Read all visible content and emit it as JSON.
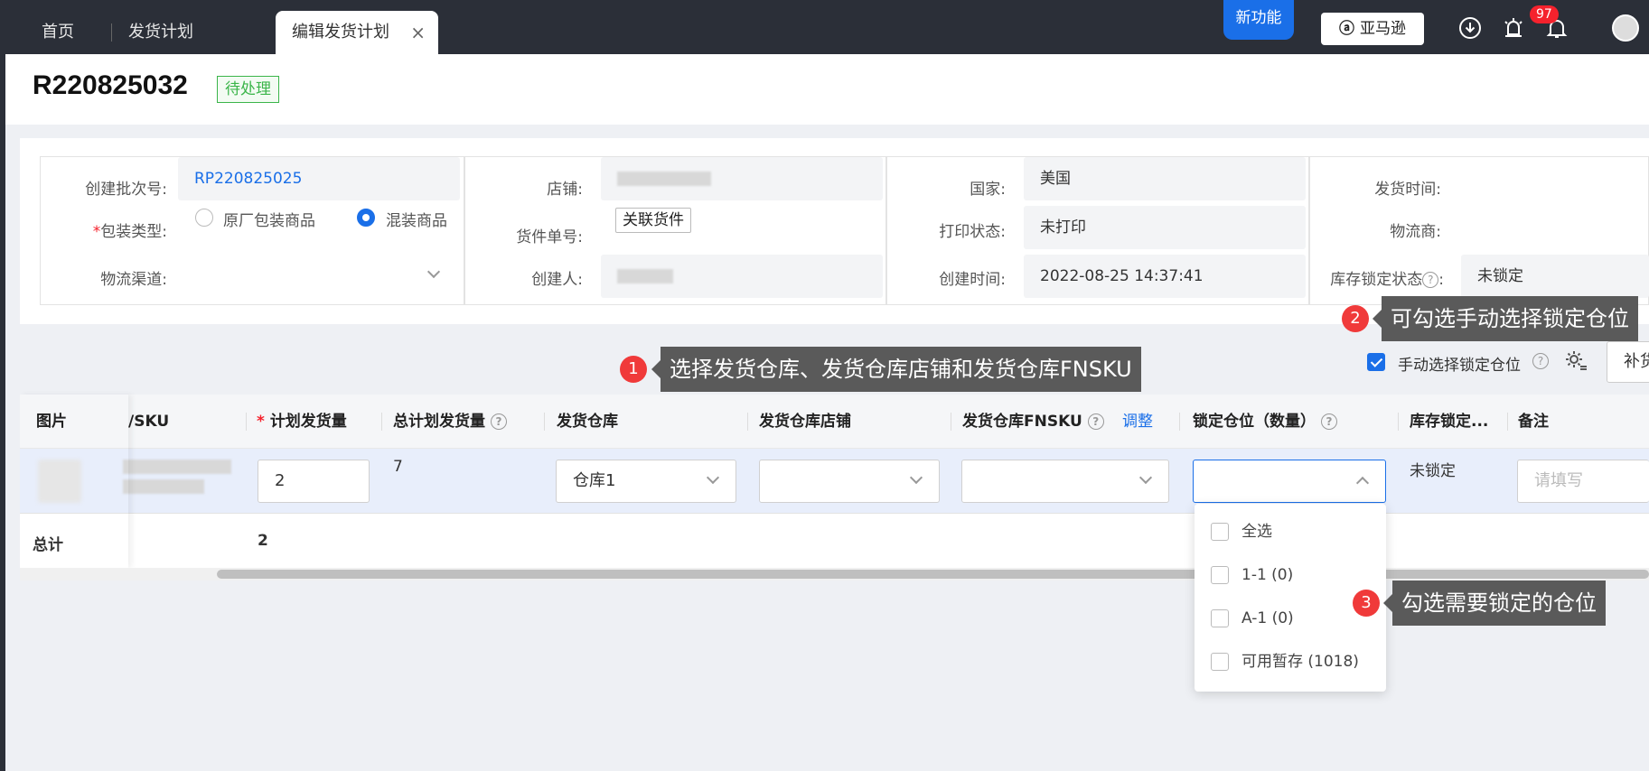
{
  "topbar": {
    "tabs": [
      {
        "label": "首页"
      },
      {
        "label": "发货计划"
      },
      {
        "label": "编辑发货计划",
        "close": "×"
      }
    ],
    "new_feature": "新功能",
    "amazon_button": "亚马逊",
    "notification_count": "97",
    "icons": [
      "download-icon",
      "bug-icon",
      "bell-icon",
      "avatar"
    ]
  },
  "header": {
    "order_no": "R220825032",
    "status": "待处理"
  },
  "info": {
    "batch_label": "创建批次号:",
    "batch_value": "RP220825025",
    "pack_label": "包装类型:",
    "pack_options": [
      "原厂包装商品",
      "混装商品"
    ],
    "pack_selected": "混装商品",
    "channel_label": "物流渠道:",
    "shop_label": "店铺:",
    "shipment_label": "货件单号:",
    "shipment_btn": "关联货件",
    "creator_label": "创建人:",
    "country_label": "国家:",
    "country_value": "美国",
    "print_label": "打印状态:",
    "print_value": "未打印",
    "created_label": "创建时间:",
    "created_value": "2022-08-25 14:37:41",
    "ship_time_label": "发货时间:",
    "carrier_label": "物流商:",
    "lock_label": "库存锁定状态",
    "lock_colon": ":",
    "lock_value": "未锁定"
  },
  "tips": [
    {
      "num": "1",
      "text": "选择发货仓库、发货仓库店铺和发货仓库FNSKU"
    },
    {
      "num": "2",
      "text": "可勾选手动选择锁定仓位"
    },
    {
      "num": "3",
      "text": "勾选需要锁定的仓位"
    }
  ],
  "toolbar": {
    "manual_lock_label": "手动选择锁定仓位",
    "manual_lock_checked": true,
    "extra_button": "补货"
  },
  "table": {
    "headers": {
      "image": "图片",
      "sku": "/SKU",
      "plan_qty": "计划发货量",
      "total_plan_qty": "总计划发货量",
      "warehouse": "发货仓库",
      "warehouse_shop": "发货仓库店铺",
      "warehouse_fnsku": "发货仓库FNSKU",
      "adjust": "调整",
      "lock_slot": "锁定仓位（数量）",
      "lock_status": "库存锁定...",
      "remark": "备注"
    },
    "row": {
      "plan_qty": "2",
      "total_plan_qty": "7",
      "warehouse": "仓库1",
      "lock_status": "未锁定",
      "remark_placeholder": "请填写"
    },
    "footer": {
      "label": "总计",
      "plan_total": "2"
    }
  },
  "dropdown": {
    "items": [
      {
        "label": "全选",
        "checked": false
      },
      {
        "label": "1-1 (0)",
        "checked": false
      },
      {
        "label": "A-1 (0)",
        "checked": false
      },
      {
        "label": "可用暂存 (1018)",
        "checked": false
      }
    ]
  },
  "colors": {
    "primary": "#1a6fe8",
    "topbar": "#2b2f38",
    "status_green": "#3bb54a",
    "badge_red": "#f5222d",
    "tip_bg": "#5a5a5a"
  }
}
